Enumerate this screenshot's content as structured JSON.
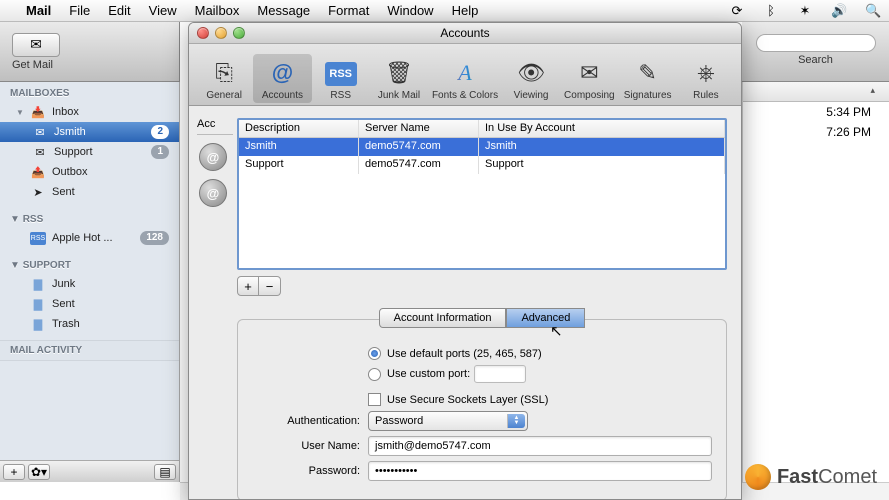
{
  "menubar": {
    "app": "Mail",
    "items": [
      "File",
      "Edit",
      "View",
      "Mailbox",
      "Message",
      "Format",
      "Window",
      "Help"
    ]
  },
  "mailToolbar": {
    "getMail": "Get Mail"
  },
  "search": {
    "label": "Search"
  },
  "sidebar": {
    "mailboxesHead": "MAILBOXES",
    "inbox": "Inbox",
    "jsmith": "Jsmith",
    "jsmithBadge": "2",
    "support": "Support",
    "supportBadge": "1",
    "outbox": "Outbox",
    "sent": "Sent",
    "rssHead": "RSS",
    "appleHot": "Apple Hot ...",
    "appleHotBadge": "128",
    "supportHead": "SUPPORT",
    "junk": "Junk",
    "sentFolder": "Sent",
    "trash": "Trash",
    "activityHead": "MAIL ACTIVITY"
  },
  "times": {
    "t1": "5:34 PM",
    "t2": "7:26 PM"
  },
  "prefs": {
    "title": "Accounts",
    "toolbar": [
      "General",
      "Accounts",
      "RSS",
      "Junk Mail",
      "Fonts & Colors",
      "Viewing",
      "Composing",
      "Signatures",
      "Rules"
    ],
    "toolbarIcons": [
      "⎘",
      "@",
      "RSS",
      "🗑",
      "A",
      "👁",
      "✉︎",
      "✎",
      "⎈"
    ],
    "accHeader": "Acc",
    "table": {
      "headers": [
        "Description",
        "Server Name",
        "In Use By Account"
      ],
      "rows": [
        {
          "desc": "Jsmith",
          "server": "demo5747.com",
          "inuse": "Jsmith"
        },
        {
          "desc": "Support",
          "server": "demo5747.com",
          "inuse": "Support"
        }
      ]
    },
    "tabs": {
      "info": "Account Information",
      "adv": "Advanced"
    },
    "adv": {
      "defaultPorts": "Use default ports (25, 465, 587)",
      "customPort": "Use custom port:",
      "ssl": "Use Secure Sockets Layer (SSL)",
      "authLabel": "Authentication:",
      "authValue": "Password",
      "userLabel": "User Name:",
      "userValue": "jsmith@demo5747.com",
      "passLabel": "Password:",
      "passValue": "•••••••••••"
    }
  },
  "logo": {
    "a": "Fast",
    "b": "Comet"
  }
}
